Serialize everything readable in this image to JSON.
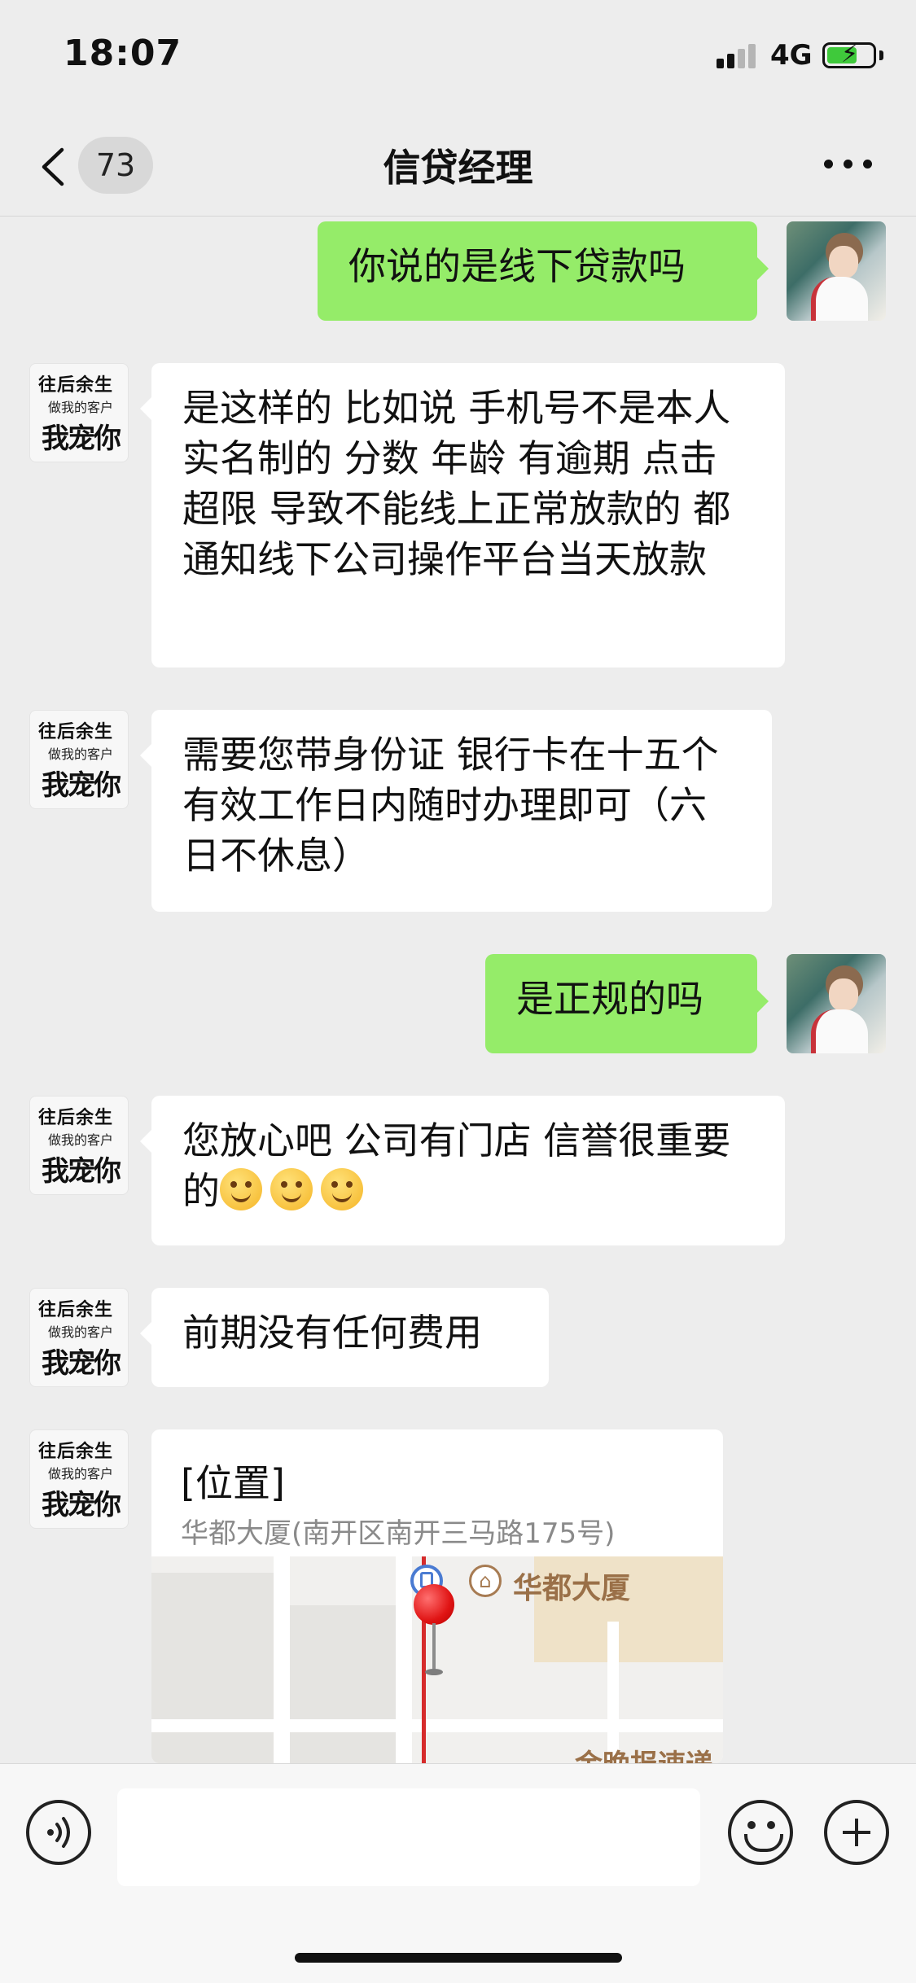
{
  "status_bar": {
    "time": "18:07",
    "network": "4G"
  },
  "nav": {
    "unread_count": "73",
    "title": "信贷经理"
  },
  "avatars": {
    "bot_line1": "往后余生",
    "bot_line2": "做我的客户",
    "bot_line3": "我宠你"
  },
  "messages": [
    {
      "side": "out",
      "text": "你说的是线下贷款吗"
    },
    {
      "side": "in",
      "text": "是这样的 比如说 手机号不是本人实名制的 分数 年龄 有逾期 点击超限 导致不能线上正常放款的 都通知线下公司操作平台当天放款"
    },
    {
      "side": "in",
      "text": "需要您带身份证 银行卡在十五个有效工作日内随时办理即可（六日不休息）"
    },
    {
      "side": "out",
      "text": "是正规的吗"
    },
    {
      "side": "in",
      "text": "您放心吧 公司有门店 信誉很重要的",
      "emoji_count": 3
    },
    {
      "side": "in",
      "text": "前期没有任何费用"
    }
  ],
  "location": {
    "title": "[位置]",
    "address": "华都大厦(南开区南开三马路175号)",
    "poi_label": "华都大厦",
    "map_bottom_label": "金晚报速递"
  },
  "colors": {
    "outgoing_bubble": "#95ec69",
    "incoming_bubble": "#ffffff",
    "background": "#ededed"
  }
}
